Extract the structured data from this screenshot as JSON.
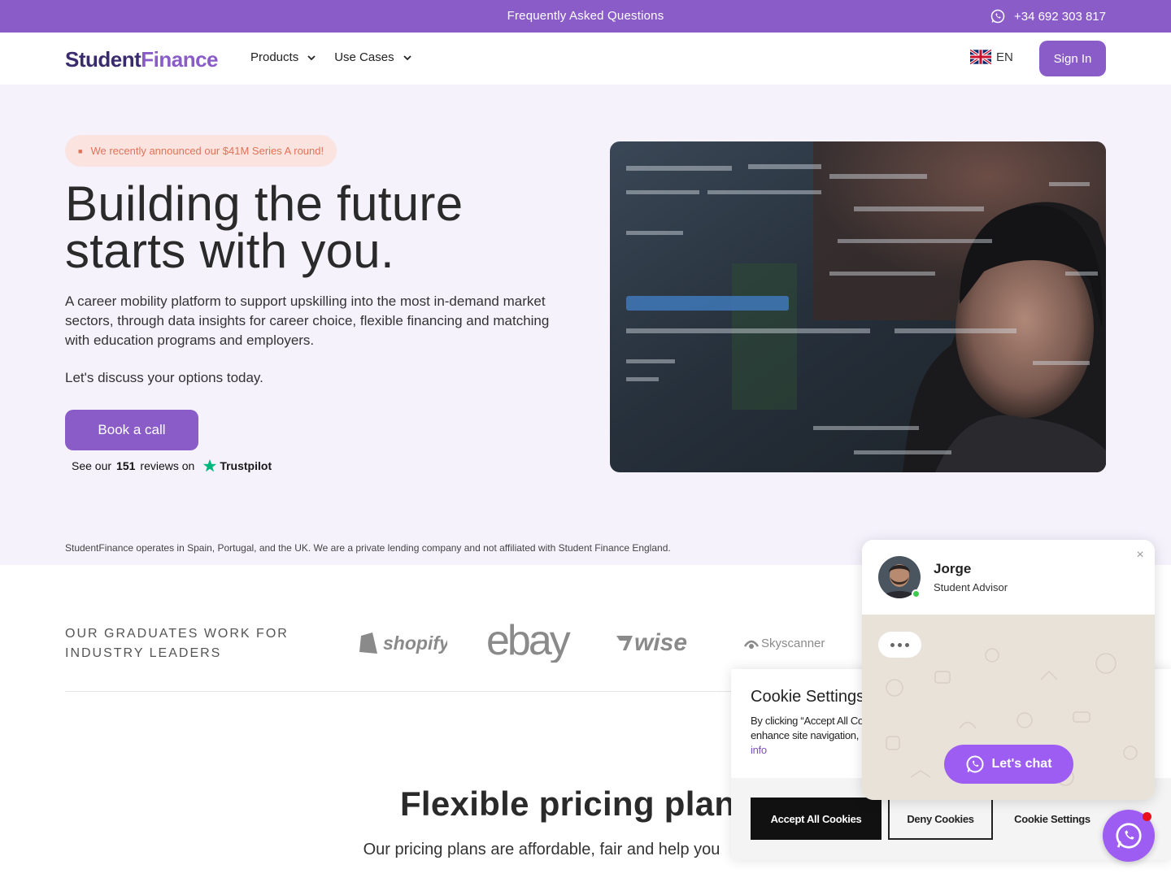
{
  "topbar": {
    "faq": "Frequently Asked Questions",
    "phone": "+34 692 303 817"
  },
  "nav": {
    "logo_part1": "Student",
    "logo_part2": "Finance",
    "menu": [
      {
        "label": "Products"
      },
      {
        "label": "Use Cases"
      }
    ],
    "language": "EN",
    "signin": "Sign In"
  },
  "hero": {
    "badge": "We recently announced our $41M Series A round!",
    "title_line1": "Building the future",
    "title_line2": "starts with you.",
    "description": "A career mobility platform to support upskilling into the most in-demand market sectors, through data insights for career choice, flexible financing and matching with education programs and employers.",
    "cta_text": "Let's discuss your options today.",
    "book_button": "Book a call",
    "trustpilot": {
      "prefix": "See our",
      "count": "151",
      "suffix": "reviews on",
      "brand": "Trustpilot"
    },
    "disclaimer": "StudentFinance operates in Spain, Portugal, and the UK. We are a private lending company and not affiliated with Student Finance England."
  },
  "partners": {
    "heading": "OUR GRADUATES WORK FOR INDUSTRY LEADERS",
    "logos": [
      "shopify",
      "ebay",
      "wise",
      "Skyscanner"
    ]
  },
  "pricing": {
    "title": "Flexible pricing plans",
    "subtitle": "Our pricing plans are affordable, fair and help you"
  },
  "cookie": {
    "title": "Cookie Settings",
    "text": "By clicking “Accept All Cookies”, you agree to the storing of cookies on your device to enhance site navigation, analyze site usage, and assist in our marketing efforts.",
    "more": "More info",
    "accept": "Accept All Cookies",
    "deny": "Deny Cookies",
    "settings": "Cookie Settings"
  },
  "chat": {
    "name": "Jorge",
    "role": "Student Advisor",
    "button": "Let's chat",
    "close": "×"
  },
  "colors": {
    "brand": "#8a5cc7",
    "chat": "#9d5df2",
    "hero_bg": "#f5f2fc"
  }
}
